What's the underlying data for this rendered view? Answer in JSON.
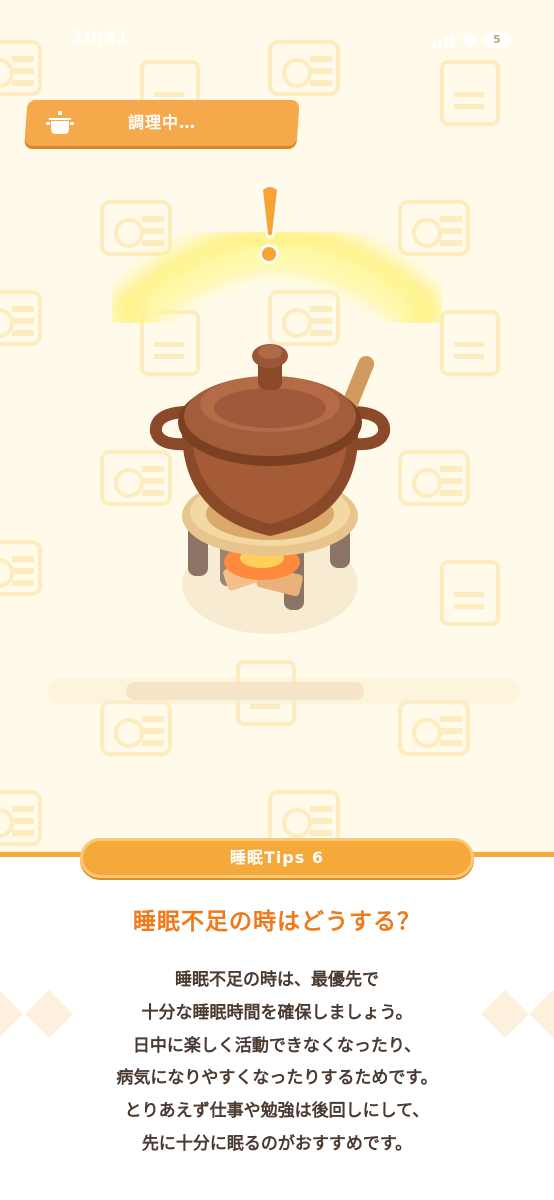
{
  "status": {
    "time": "10:41",
    "battery": "5"
  },
  "cooking": {
    "label": "調理中…",
    "progress": 0.67
  },
  "tips": {
    "header": "睡眠Tips 6",
    "title": "睡眠不足の時はどうする？",
    "lines": [
      "睡眠不足の時は、最優先で",
      "十分な睡眠時間を確保しましょう。",
      "日中に楽しく活動できなくなったり、",
      "病気になりやすくなったりするためです。",
      "とりあえず仕事や勉強は後回しにして、",
      "先に十分に眠るのがおすすめです。"
    ]
  },
  "icons": {
    "banner": "cooking-pot-icon",
    "alert": "exclamation-icon"
  },
  "colors": {
    "accent": "#f6a93b",
    "title": "#f07a1a",
    "background": "#fffaea"
  }
}
